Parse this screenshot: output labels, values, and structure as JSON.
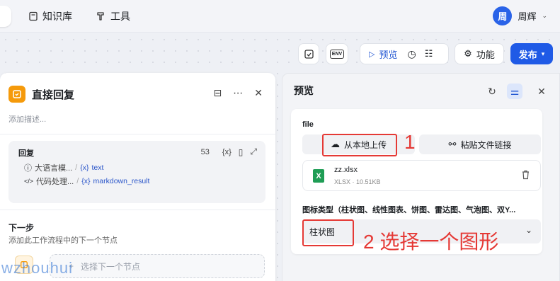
{
  "nav": {
    "items": [
      {
        "label": "知识库"
      },
      {
        "label": "工具"
      }
    ],
    "user": {
      "avatar_text": "周",
      "name": "周辉"
    }
  },
  "toolbar": {
    "preview_label": "预览",
    "feature_label": "功能",
    "publish_label": "发布",
    "env_label": "ENV"
  },
  "node": {
    "title": "直接回复",
    "description": "添加描述...",
    "reply_label": "回复",
    "reply_count": "53",
    "vars": [
      {
        "source": "大语言模...",
        "var": "text"
      },
      {
        "source": "代码处理...",
        "var": "markdown_result"
      }
    ],
    "next_title": "下一步",
    "next_desc": "添加此工作流程中的下一个节点",
    "next_placeholder": "选择下一个节点"
  },
  "preview": {
    "title": "预览",
    "file_label": "file",
    "upload_local": "从本地上传",
    "paste_link": "粘贴文件链接",
    "file": {
      "name": "zz.xlsx",
      "meta": "XLSX · 10.51KB"
    },
    "chart_type_label": "图标类型（柱状图、线性图表、饼图、雷达图、气泡图、双Y...",
    "chart_type_value": "柱状图"
  },
  "annotations": {
    "step1": "1",
    "step2": "2 选择一个图形"
  },
  "watermark": "wzhouhui",
  "colors": {
    "primary": "#1f5ae6",
    "node_icon": "#f59a0b",
    "annotation": "#e53935"
  }
}
